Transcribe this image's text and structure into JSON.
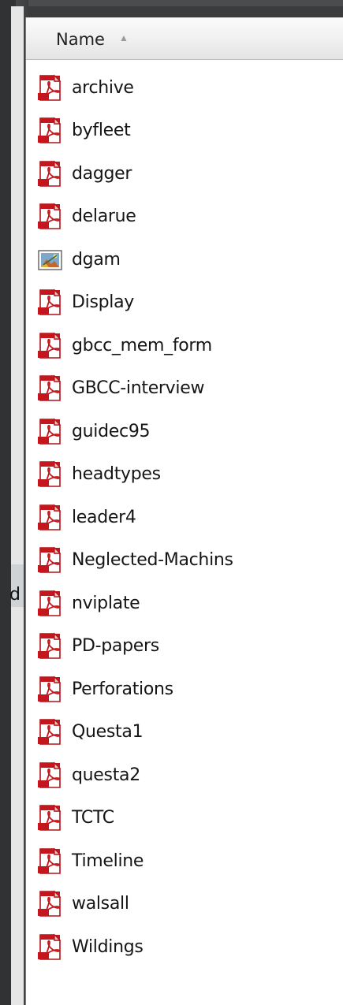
{
  "header": {
    "column_label": "Name",
    "sort_icon": "sort-ascending-icon"
  },
  "side_pane": {
    "clipped_text": "d"
  },
  "files": [
    {
      "name": "archive",
      "icon": "pdf-file-icon"
    },
    {
      "name": "byfleet",
      "icon": "pdf-file-icon"
    },
    {
      "name": "dagger",
      "icon": "pdf-file-icon"
    },
    {
      "name": "delarue",
      "icon": "pdf-file-icon"
    },
    {
      "name": "dgam",
      "icon": "image-file-icon"
    },
    {
      "name": "Display",
      "icon": "pdf-file-icon"
    },
    {
      "name": "gbcc_mem_form",
      "icon": "pdf-file-icon"
    },
    {
      "name": "GBCC-interview",
      "icon": "pdf-file-icon"
    },
    {
      "name": "guidec95",
      "icon": "pdf-file-icon"
    },
    {
      "name": "headtypes",
      "icon": "pdf-file-icon"
    },
    {
      "name": "leader4",
      "icon": "pdf-file-icon"
    },
    {
      "name": "Neglected-Machins",
      "icon": "pdf-file-icon"
    },
    {
      "name": "nviplate",
      "icon": "pdf-file-icon"
    },
    {
      "name": "PD-papers",
      "icon": "pdf-file-icon"
    },
    {
      "name": "Perforations",
      "icon": "pdf-file-icon"
    },
    {
      "name": "Questa1",
      "icon": "pdf-file-icon"
    },
    {
      "name": "questa2",
      "icon": "pdf-file-icon"
    },
    {
      "name": "TCTC",
      "icon": "pdf-file-icon"
    },
    {
      "name": "Timeline",
      "icon": "pdf-file-icon"
    },
    {
      "name": "walsall",
      "icon": "pdf-file-icon"
    },
    {
      "name": "Wildings",
      "icon": "pdf-file-icon"
    }
  ],
  "colors": {
    "pdf_red": "#c4161c",
    "frame_dark": "#3a3c3e",
    "panel_bg": "#ffffff"
  }
}
